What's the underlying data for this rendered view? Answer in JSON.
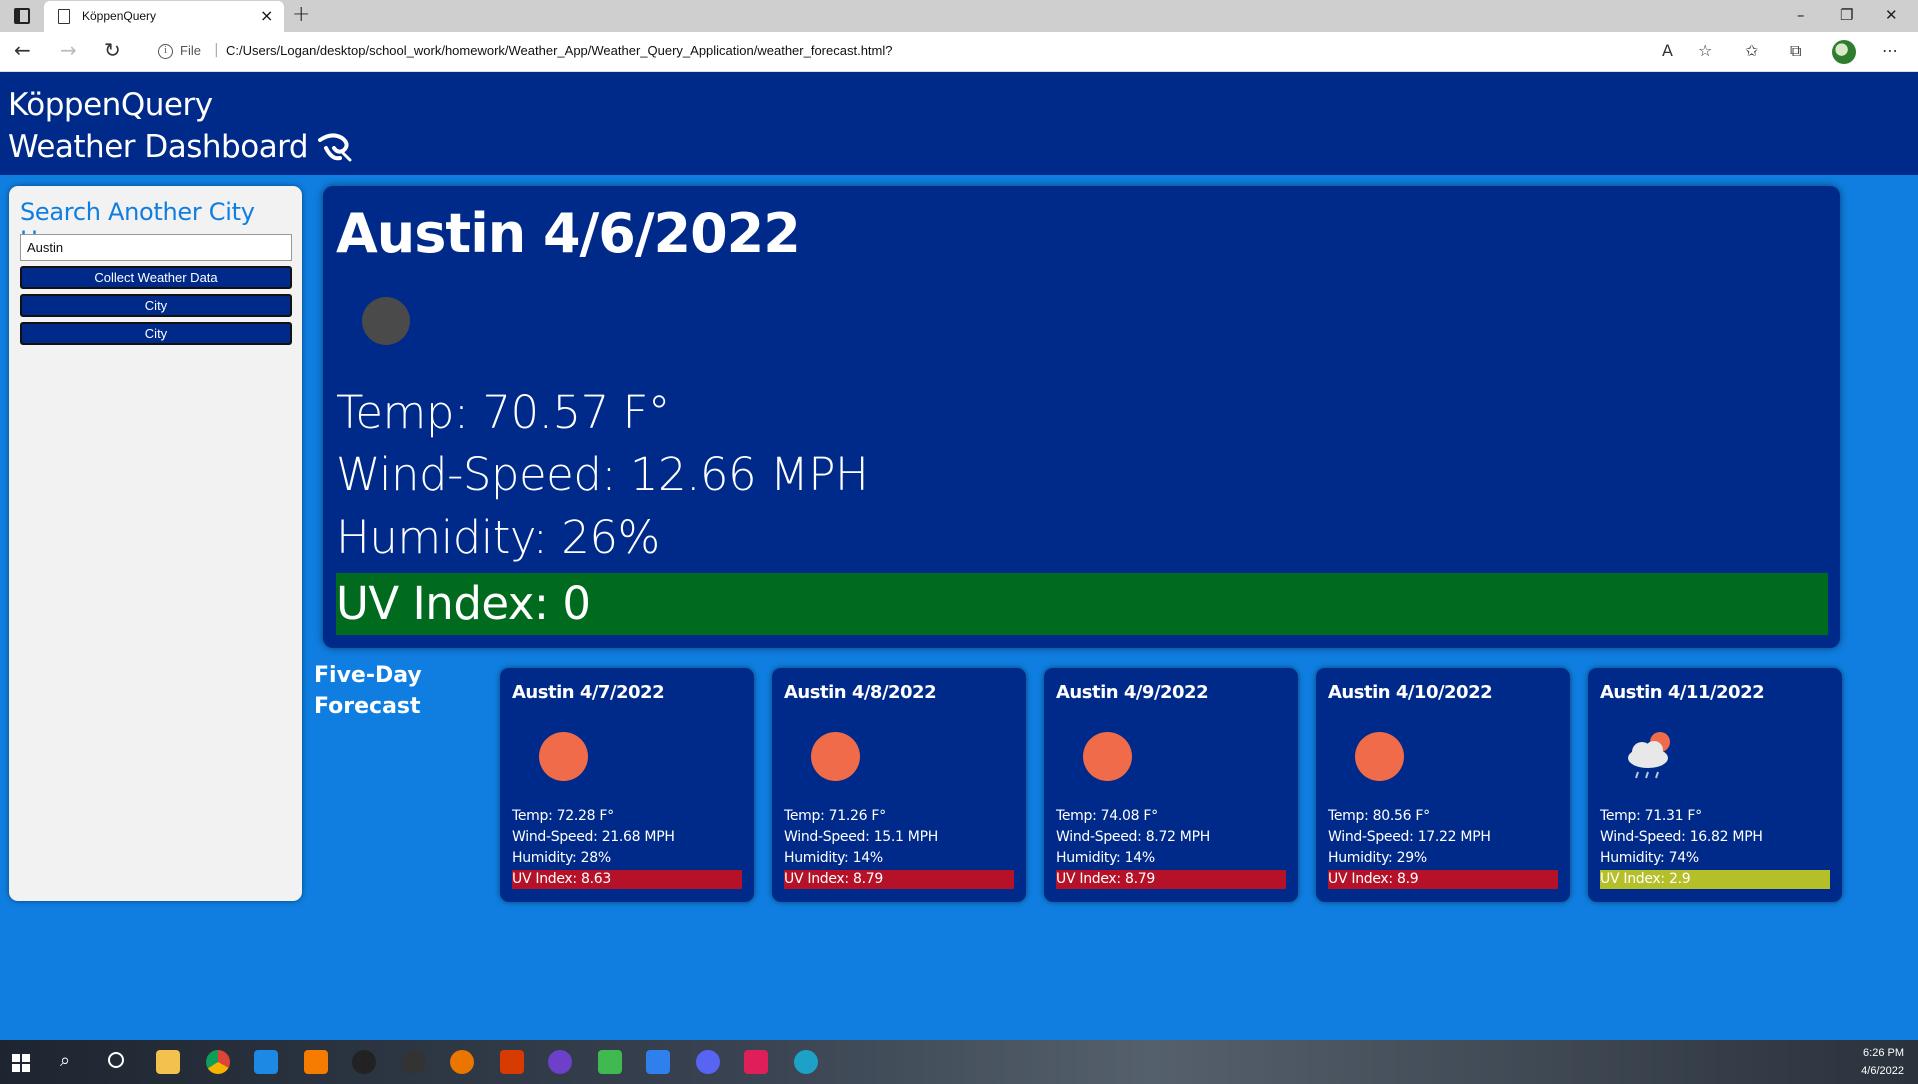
{
  "browser": {
    "tab_title": "KöppenQuery",
    "tab_close": "×",
    "new_tab": "+",
    "url_scheme_label": "File",
    "url": "C:/Users/Logan/desktop/school_work/homework/Weather_App/Weather_Query_Application/weather_forecast.html?",
    "window_controls": [
      "–",
      "❐",
      "✕"
    ]
  },
  "header": {
    "title_line1": "KöppenQuery",
    "title_line2": "Weather Dashboard"
  },
  "sidebar": {
    "heading": "Search Another City Here",
    "input_value": "Austin",
    "submit_label": "Collect Weather Data",
    "history": [
      "City",
      "City"
    ]
  },
  "current": {
    "city_date": "Austin 4/6/2022",
    "temp": "Temp: 70.57 F°",
    "wind": "Wind-Speed: 12.66 MPH",
    "humidity": "Humidity: 26%",
    "uv": "UV Index: 0",
    "uv_color": "#006b1f"
  },
  "forecast": {
    "label_line1": "Five-Day",
    "label_line2": "Forecast",
    "days": [
      {
        "title": "Austin 4/7/2022",
        "icon": "sun-icon",
        "temp": "Temp: 72.28 F°",
        "wind": "Wind-Speed: 21.68 MPH",
        "humidity": "Humidity: 28%",
        "uv": "UV Index: 8.63",
        "uv_color": "#b5122a"
      },
      {
        "title": "Austin 4/8/2022",
        "icon": "sun-icon",
        "temp": "Temp: 71.26 F°",
        "wind": "Wind-Speed: 15.1 MPH",
        "humidity": "Humidity: 14%",
        "uv": "UV Index: 8.79",
        "uv_color": "#b5122a"
      },
      {
        "title": "Austin 4/9/2022",
        "icon": "sun-icon",
        "temp": "Temp: 74.08 F°",
        "wind": "Wind-Speed: 8.72 MPH",
        "humidity": "Humidity: 14%",
        "uv": "UV Index: 8.79",
        "uv_color": "#b5122a"
      },
      {
        "title": "Austin 4/10/2022",
        "icon": "sun-icon",
        "temp": "Temp: 80.56 F°",
        "wind": "Wind-Speed: 17.22 MPH",
        "humidity": "Humidity: 29%",
        "uv": "UV Index: 8.9",
        "uv_color": "#b5122a"
      },
      {
        "title": "Austin 4/11/2022",
        "icon": "cloud-rain-icon",
        "temp": "Temp: 71.31 F°",
        "wind": "Wind-Speed: 16.82 MPH",
        "humidity": "Humidity: 74%",
        "uv": "UV Index: 2.9",
        "uv_color": "#b5bf2a"
      }
    ]
  },
  "taskbar": {
    "time": "6:26 PM",
    "date": "4/6/2022"
  }
}
